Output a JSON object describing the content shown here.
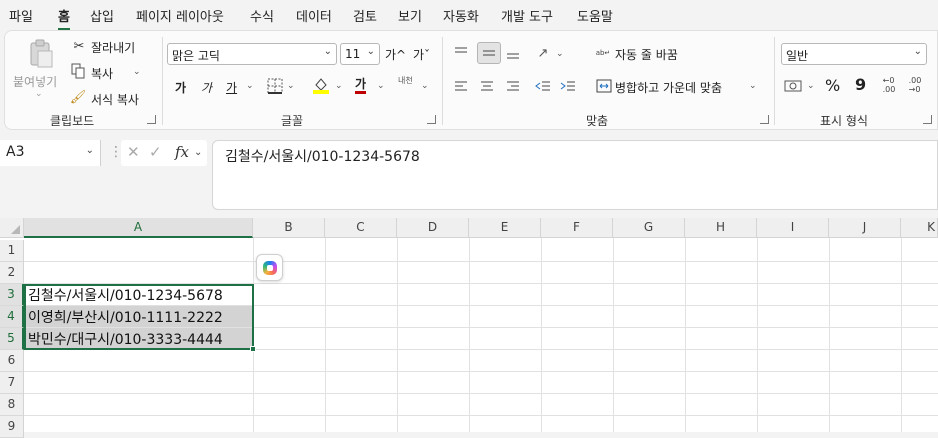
{
  "menu": {
    "tabs": [
      {
        "label": "파일"
      },
      {
        "label": "홈"
      },
      {
        "label": "삽입"
      },
      {
        "label": "페이지 레이아웃"
      },
      {
        "label": "수식"
      },
      {
        "label": "데이터"
      },
      {
        "label": "검토"
      },
      {
        "label": "보기"
      },
      {
        "label": "자동화"
      },
      {
        "label": "개발 도구"
      },
      {
        "label": "도움말"
      }
    ],
    "active": "홈"
  },
  "ribbon": {
    "clipboard": {
      "paste": "붙여넣기",
      "cut": "잘라내기",
      "copy": "복사",
      "format_painter": "서식 복사",
      "label": "클립보드"
    },
    "font": {
      "name": "맑은 고딕",
      "size": "11",
      "grow": "가^",
      "shrink": "가ˇ",
      "bold": "가",
      "italic": "가",
      "underline": "가",
      "font_color_glyph": "가",
      "phonetic": "내천",
      "label": "글꼴"
    },
    "alignment": {
      "wrap_text": "자동 줄 바꿈",
      "merge_center": "병합하고 가운데 맞춤",
      "label": "맞춤"
    },
    "number": {
      "format": "일반",
      "percent": "%",
      "comma": "9",
      "label": "표시 형식"
    }
  },
  "formula_bar": {
    "name_box": "A3",
    "fx": "fx",
    "content": "김철수/서울시/010-1234-5678"
  },
  "sheet": {
    "columns": [
      "A",
      "B",
      "C",
      "D",
      "E",
      "F",
      "G",
      "H",
      "I",
      "J",
      "K"
    ],
    "rows": [
      "1",
      "2",
      "3",
      "4",
      "5",
      "6",
      "7",
      "8",
      "9"
    ],
    "selected_column": "A",
    "selected_rows": [
      "3",
      "4",
      "5"
    ],
    "cells": {
      "A3": "김철수/서울시/010-1234-5678",
      "A4": "이영희/부산시/010-1111-2222",
      "A5": "박민수/대구시/010-3333-4444"
    }
  },
  "colors": {
    "accent": "#217346",
    "selection_border": "#1e7145",
    "selection_fill": "#d3d3d3",
    "underline_bar": "#c00000",
    "fill_bar": "#ffff00"
  }
}
